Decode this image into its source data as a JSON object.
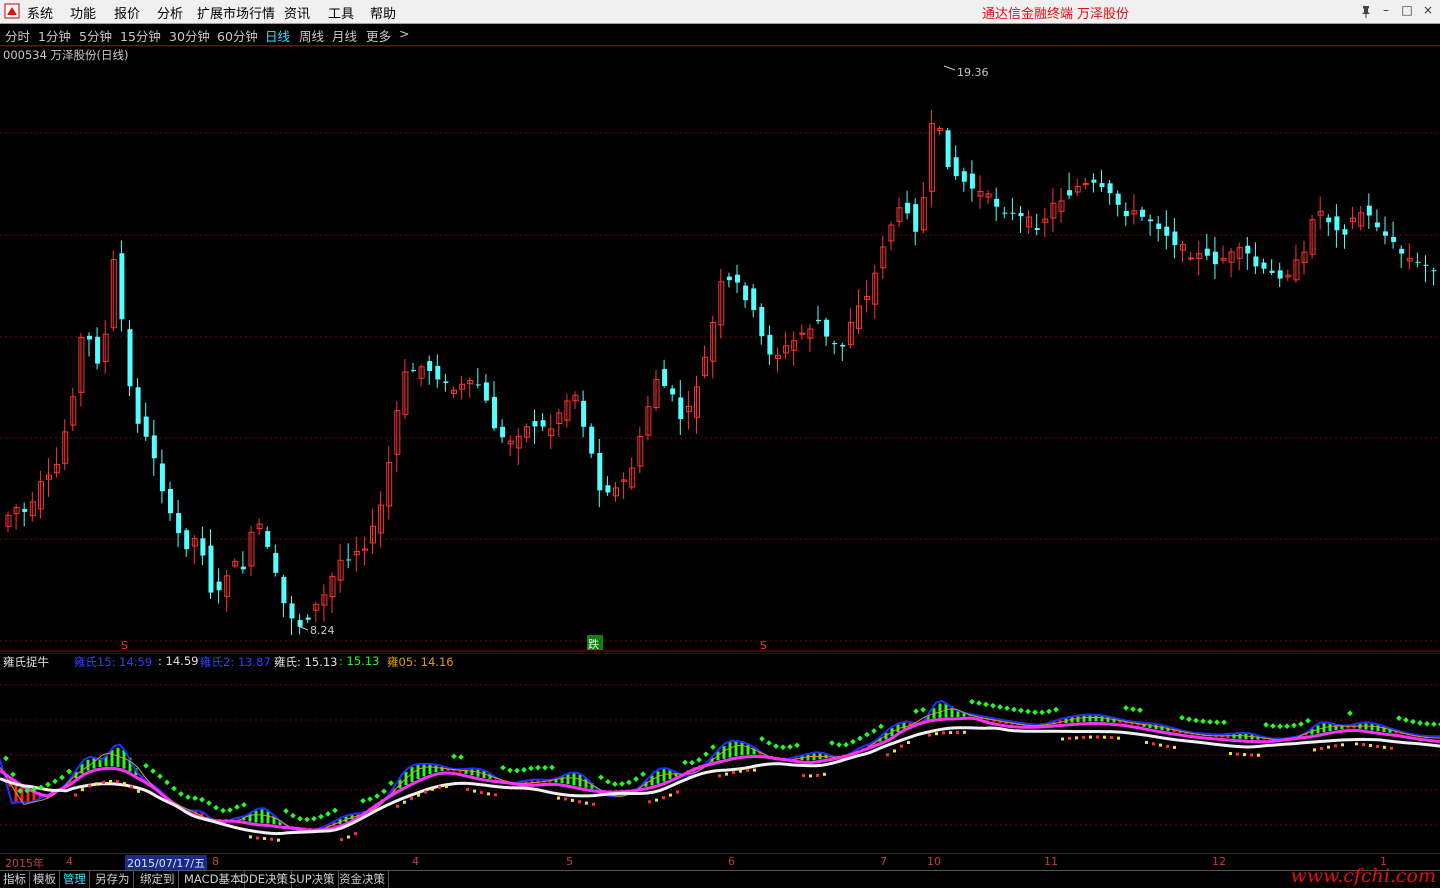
{
  "menubar": {
    "items": [
      "系统",
      "功能",
      "报价",
      "分析",
      "扩展市场行情",
      "资讯",
      "工具",
      "帮助"
    ],
    "right_text": "通达信金融终端",
    "right_stock": "万泽股份"
  },
  "periods": {
    "items": [
      "分时",
      "1分钟",
      "5分钟",
      "15分钟",
      "30分钟",
      "60分钟",
      "日线",
      "周线",
      "月线",
      "更多"
    ],
    "active": "日线",
    "more_arrow": ">"
  },
  "chart": {
    "title": "000534 万泽股份(日线)",
    "high_label": "19.36",
    "low_label": "8.24",
    "signal_s1": "S",
    "signal_die": "跌",
    "signal_s2": "S",
    "colors": {
      "up": "#ff3232",
      "down": "#54ffff",
      "grid": "#7a0000"
    }
  },
  "indicator": {
    "name": "雍氏捉牛",
    "items": [
      {
        "label": "雍氏15: 14.59",
        "color": "#3040ff"
      },
      {
        "label": ": 14.59",
        "color": "#e0e0e0"
      },
      {
        "label": "雍氏2: 13.87",
        "color": "#3040ff"
      },
      {
        "label": "雍氏: 15.13",
        "color": "#e0e0e0"
      },
      {
        "label": ": 15.13",
        "color": "#20ff20"
      },
      {
        "label": "雍05: 14.16",
        "color": "#e0a000"
      }
    ]
  },
  "date_axis": {
    "labels": [
      "2015年",
      "4",
      "2015/07/17/五",
      "8",
      "4",
      "5",
      "6",
      "7",
      "10",
      "11",
      "12",
      "1"
    ]
  },
  "tabs": {
    "items": [
      "指标",
      "模板",
      "管理",
      "另存为",
      "绑定到",
      "MACD基本",
      "DDE决策",
      "SUP决策",
      "资金决策"
    ],
    "active": "管理"
  },
  "watermark": "www.cfchi.com"
}
